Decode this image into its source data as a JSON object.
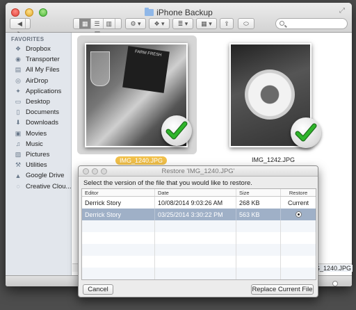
{
  "window": {
    "title": "iPhone Backup"
  },
  "toolbar": {
    "back_icon": "chevron-left-icon",
    "forward_icon": "chevron-right-icon",
    "view_icons": [
      "icon-view-icon",
      "list-view-icon",
      "column-view-icon",
      "cover-flow-icon"
    ],
    "action_icon": "gear-icon",
    "dropbox_icon": "dropbox-icon",
    "arrange_icon": "arrange-icon",
    "share_icon": "share-icon",
    "tags_icon": "tag-icon",
    "search_placeholder": ""
  },
  "sidebar": {
    "heading": "FAVORITES",
    "items": [
      {
        "label": "Dropbox",
        "icon": "dropbox-icon"
      },
      {
        "label": "Transporter",
        "icon": "transporter-icon"
      },
      {
        "label": "All My Files",
        "icon": "all-files-icon"
      },
      {
        "label": "AirDrop",
        "icon": "airdrop-icon"
      },
      {
        "label": "Applications",
        "icon": "applications-icon"
      },
      {
        "label": "Desktop",
        "icon": "desktop-icon"
      },
      {
        "label": "Documents",
        "icon": "documents-icon"
      },
      {
        "label": "Downloads",
        "icon": "downloads-icon"
      },
      {
        "label": "Movies",
        "icon": "movies-icon"
      },
      {
        "label": "Music",
        "icon": "music-icon"
      },
      {
        "label": "Pictures",
        "icon": "pictures-icon"
      },
      {
        "label": "Utilities",
        "icon": "utilities-icon"
      },
      {
        "label": "Google Drive",
        "icon": "google-drive-icon"
      },
      {
        "label": "Creative Clou...",
        "icon": "creative-cloud-icon"
      }
    ]
  },
  "files": [
    {
      "name": "IMG_1240.JPG",
      "selected": true
    },
    {
      "name": "IMG_1242.JPG",
      "selected": false
    }
  ],
  "photo1_menu_text": "FARM FRESH",
  "path_label": "IMG_1240.JPG",
  "restore_sheet": {
    "title": "Restore 'IMG_1240.JPG'",
    "message": "Select the version of the file that you would like to restore.",
    "columns": {
      "editor": "Editor",
      "date": "Date",
      "size": "Size",
      "restore": "Restore"
    },
    "rows": [
      {
        "editor": "Derrick Story",
        "date": "10/08/2014 9:03:26 AM",
        "size": "268 KB",
        "restore": "Current"
      },
      {
        "editor": "Derrick Story",
        "date": "03/25/2014 3:30:22 PM",
        "size": "563 KB",
        "restore": "radio-selected-icon"
      }
    ],
    "cancel_label": "Cancel",
    "replace_label": "Replace Current File"
  },
  "colors": {
    "selection_highlight": "#9fb0c7",
    "filename_badge": "#f1c04a",
    "checkmark_green": "#2fb52b"
  }
}
